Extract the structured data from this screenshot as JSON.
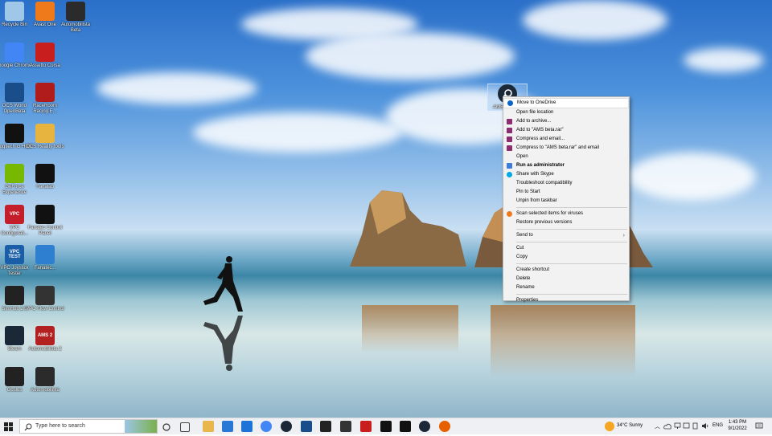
{
  "desktop_icons": [
    {
      "label": "Recycle Bin",
      "icon": "recycle-bin-icon",
      "color": "#9fc7e8"
    },
    {
      "label": "Avast One",
      "icon": "avast-icon",
      "color": "#ee7a1c"
    },
    {
      "label": "Automobilista Beta",
      "icon": "helmet-icon",
      "color": "#2b2b2b"
    },
    {
      "label": "Google Chrome",
      "icon": "chrome-icon",
      "color": "#4285f4"
    },
    {
      "label": "Assetto Corsa",
      "icon": "assetto-icon",
      "color": "#c81e1e"
    },
    {
      "label": "DCS World OpenBeta",
      "icon": "dcs-icon",
      "color": "#1a4e8a"
    },
    {
      "label": "RaceRoom Racing E...",
      "icon": "raceroom-icon",
      "color": "#b01c1c"
    },
    {
      "label": "Logitech G HUB",
      "icon": "logitech-icon",
      "color": "#111111"
    },
    {
      "label": "DCS Reality tools",
      "icon": "folder-icon",
      "color": "#e7b43f"
    },
    {
      "label": "GeForce Experience",
      "icon": "geforce-icon",
      "color": "#76b900"
    },
    {
      "label": "Fanalab",
      "icon": "fanalab-icon",
      "color": "#111111"
    },
    {
      "label": "VPC Configurati...",
      "icon": "vpc-icon",
      "color": "#c41e2a",
      "text": "VPC"
    },
    {
      "label": "Fanatec Control Panel",
      "icon": "fanatec-icon",
      "color": "#111111"
    },
    {
      "label": "VPC Joystick Tester",
      "icon": "vpc-test-icon",
      "color": "#1b5ea8",
      "text": "VPC TEST"
    },
    {
      "label": "Fanatec...",
      "icon": "fanatec-app-icon",
      "color": "#2f7fd0"
    },
    {
      "label": "SimHub 2.0",
      "icon": "simhub-icon",
      "color": "#222222"
    },
    {
      "label": "VPC Flow Control",
      "icon": "vpc-flow-icon",
      "color": "#333333"
    },
    {
      "label": "Steam",
      "icon": "steam-icon",
      "color": "#1b2838"
    },
    {
      "label": "Automobilista 2",
      "icon": "ams2-icon",
      "color": "#b32020",
      "text": "AMS 2"
    },
    {
      "label": "Oculus",
      "icon": "oculus-icon",
      "color": "#222222"
    },
    {
      "label": "Automobilista",
      "icon": "automobilista-icon",
      "color": "#2b2b2b"
    }
  ],
  "selected_icon": {
    "label": "AMS",
    "icon": "steam-shortcut-icon"
  },
  "context_menu": {
    "items": [
      {
        "label": "Move to OneDrive",
        "icon": "onedrive-icon",
        "color": "#0a64c8",
        "highlight": true
      },
      {
        "label": "Open file location"
      },
      {
        "label": "Add to archive...",
        "icon": "winrar-icon",
        "color": "#8b2d6e"
      },
      {
        "label": "Add to \"AMS beta.rar\"",
        "icon": "winrar-icon",
        "color": "#8b2d6e"
      },
      {
        "label": "Compress and email...",
        "icon": "winrar-icon",
        "color": "#8b2d6e"
      },
      {
        "label": "Compress to \"AMS beta.rar\" and email",
        "icon": "winrar-icon",
        "color": "#8b2d6e"
      },
      {
        "label": "Open"
      },
      {
        "label": "Run as administrator",
        "icon": "shield-icon",
        "color": "#3b7dd8",
        "bold": true
      },
      {
        "label": "Share with Skype",
        "icon": "skype-icon",
        "color": "#00a8e8"
      },
      {
        "label": "Troubleshoot compatibility"
      },
      {
        "label": "Pin to Start"
      },
      {
        "label": "Unpin from taskbar"
      },
      {
        "separator": true
      },
      {
        "label": "Scan selected items for viruses",
        "icon": "avast-icon",
        "color": "#ee7a1c"
      },
      {
        "label": "Restore previous versions"
      },
      {
        "separator": true
      },
      {
        "label": "Send to",
        "submenu": true
      },
      {
        "separator": true
      },
      {
        "label": "Cut"
      },
      {
        "label": "Copy"
      },
      {
        "separator": true
      },
      {
        "label": "Create shortcut"
      },
      {
        "label": "Delete"
      },
      {
        "label": "Rename"
      },
      {
        "separator": true
      },
      {
        "label": "Properties"
      }
    ]
  },
  "taskbar": {
    "search_placeholder": "Type here to search",
    "pinned": [
      {
        "icon": "task-view-icon",
        "color": "#444444"
      },
      {
        "icon": "file-explorer-icon",
        "color": "#e8b64a"
      },
      {
        "icon": "microsoft-store-icon",
        "color": "#2a78d6"
      },
      {
        "icon": "mail-icon",
        "color": "#1d74d6"
      },
      {
        "icon": "chrome-icon",
        "color": "#4285f4"
      },
      {
        "icon": "steam-icon",
        "color": "#1b2838"
      },
      {
        "icon": "dcs-icon",
        "color": "#1a4e8a"
      },
      {
        "icon": "simhub-icon",
        "color": "#222222"
      },
      {
        "icon": "oculus-icon",
        "color": "#333333"
      },
      {
        "icon": "assetto-icon",
        "color": "#c81e1e"
      },
      {
        "icon": "fanalab-icon",
        "color": "#111111"
      },
      {
        "icon": "fanatec-icon",
        "color": "#111111"
      },
      {
        "icon": "steam-icon",
        "color": "#1b2838"
      },
      {
        "icon": "firefox-icon",
        "color": "#e66000"
      }
    ],
    "weather": "34°C  Sunny",
    "language": "ENG",
    "time": "1:43 PM",
    "date": "9/1/2022"
  }
}
